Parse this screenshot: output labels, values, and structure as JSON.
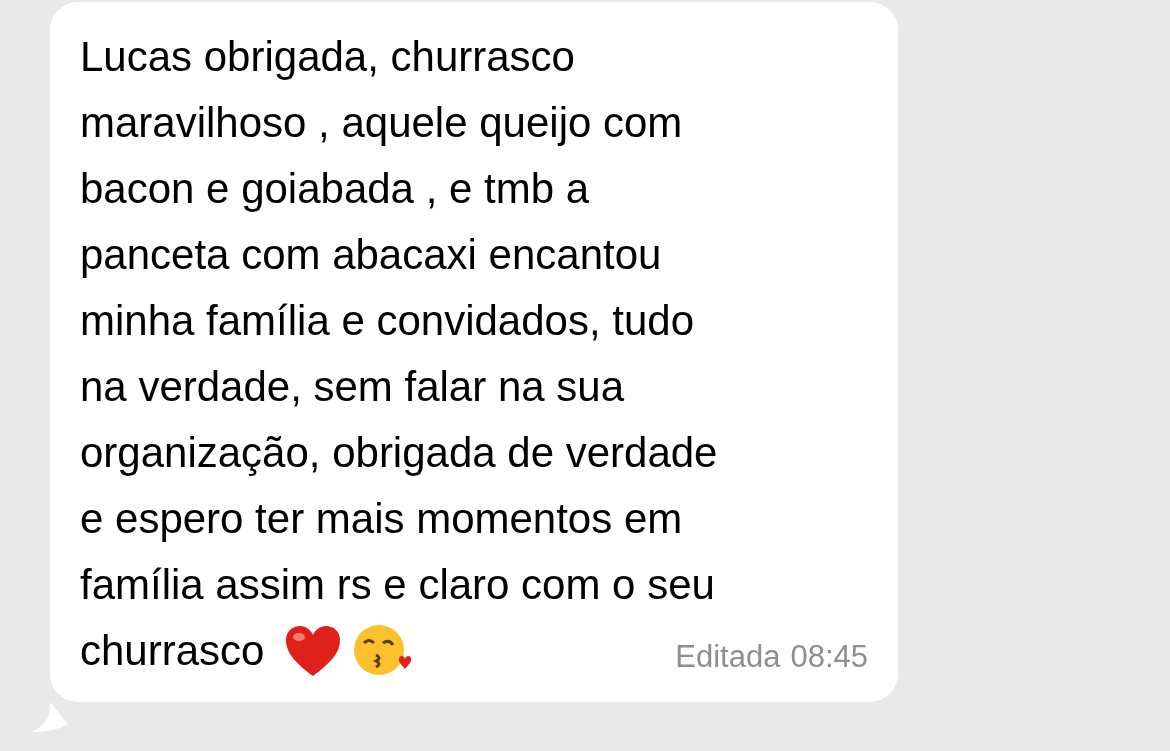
{
  "message": {
    "lines": [
      "Lucas obrigada, churrasco",
      "maravilhoso , aquele queijo com",
      "bacon e goiabada , e tmb a",
      "panceta com abacaxi encantou",
      "minha família e convidados, tudo",
      "na verdade, sem falar na sua",
      "organização, obrigada de verdade",
      "e espero ter mais momentos em",
      "família assim rs e claro com o seu"
    ],
    "last_line": "churrasco",
    "edited_label": "Editada",
    "time": "08:45"
  }
}
